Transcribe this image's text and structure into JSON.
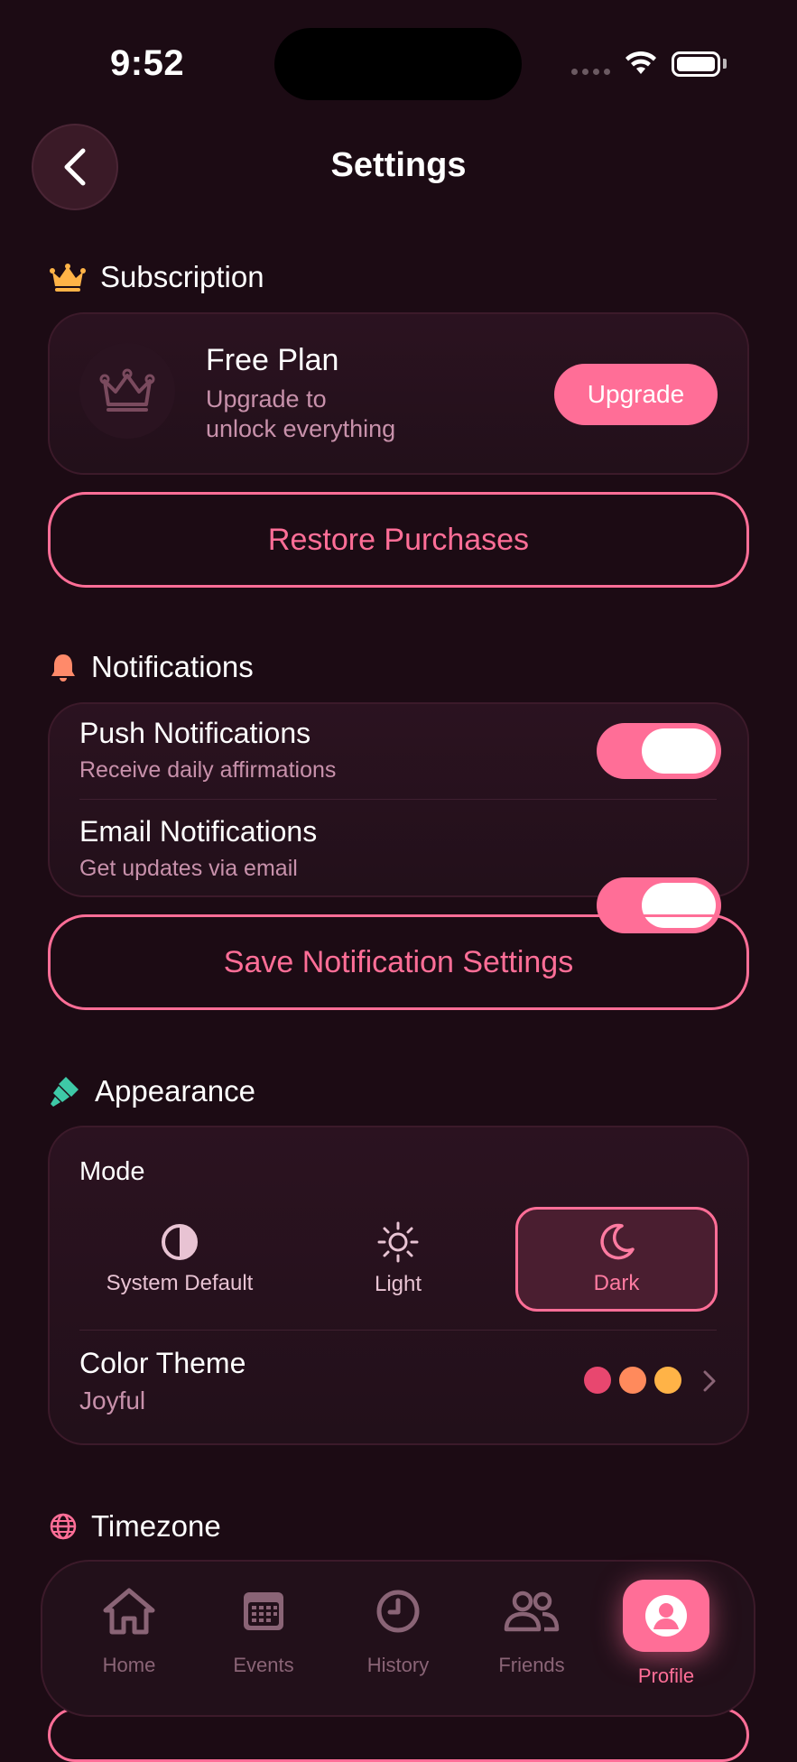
{
  "status_bar": {
    "time": "9:52"
  },
  "header": {
    "title": "Settings"
  },
  "subscription": {
    "heading": "Subscription",
    "plan_title": "Free Plan",
    "plan_subtitle_line1": "Upgrade to",
    "plan_subtitle_line2": "unlock everything",
    "upgrade_label": "Upgrade",
    "restore_label": "Restore Purchases"
  },
  "notifications": {
    "heading": "Notifications",
    "items": [
      {
        "title": "Push Notifications",
        "subtitle": "Receive daily affirmations",
        "enabled": true
      },
      {
        "title": "Email Notifications",
        "subtitle": "Get updates via email",
        "enabled": true
      }
    ],
    "save_label": "Save Notification Settings"
  },
  "appearance": {
    "heading": "Appearance",
    "mode_label": "Mode",
    "modes": [
      {
        "label": "System Default",
        "icon": "half-circle-icon",
        "selected": false
      },
      {
        "label": "Light",
        "icon": "sun-icon",
        "selected": false
      },
      {
        "label": "Dark",
        "icon": "moon-icon",
        "selected": true
      }
    ],
    "color_theme_label": "Color Theme",
    "color_theme_value": "Joyful",
    "theme_colors": [
      "#e8476f",
      "#ff8a5c",
      "#ffb347"
    ]
  },
  "timezone": {
    "heading": "Timezone"
  },
  "tabbar": {
    "tabs": [
      {
        "label": "Home",
        "icon": "home-icon",
        "active": false
      },
      {
        "label": "Events",
        "icon": "calendar-icon",
        "active": false
      },
      {
        "label": "History",
        "icon": "clock-icon",
        "active": false
      },
      {
        "label": "Friends",
        "icon": "people-icon",
        "active": false
      },
      {
        "label": "Profile",
        "icon": "user-icon",
        "active": true
      }
    ]
  },
  "colors": {
    "accent": "#ff6e97",
    "background": "#1c0b14",
    "card": "#22101a",
    "muted_text": "#c891ab"
  }
}
